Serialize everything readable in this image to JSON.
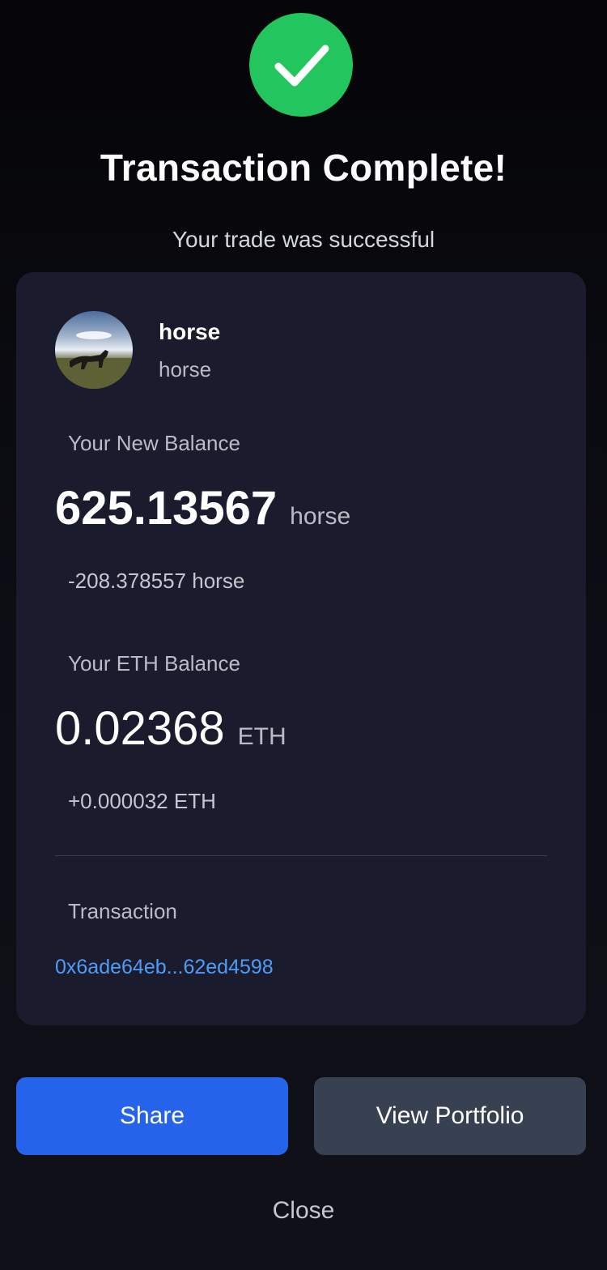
{
  "header": {
    "title": "Transaction Complete!",
    "subtitle": "Your trade was successful",
    "status_color": "#22c55e"
  },
  "token": {
    "name": "horse",
    "symbol": "horse",
    "avatar_icon": "horse-image"
  },
  "token_balance": {
    "label": "Your New Balance",
    "value": "625.13567",
    "unit": "horse",
    "change": "-208.378557 horse"
  },
  "eth_balance": {
    "label": "Your ETH Balance",
    "value": "0.02368",
    "unit": "ETH",
    "change": "+0.000032 ETH"
  },
  "transaction": {
    "label": "Transaction",
    "hash": "0x6ade64eb...62ed4598",
    "link_color": "#4f9cf6"
  },
  "actions": {
    "share_label": "Share",
    "portfolio_label": "View Portfolio",
    "close_label": "Close",
    "share_color": "#2563eb",
    "portfolio_color": "#374151"
  }
}
